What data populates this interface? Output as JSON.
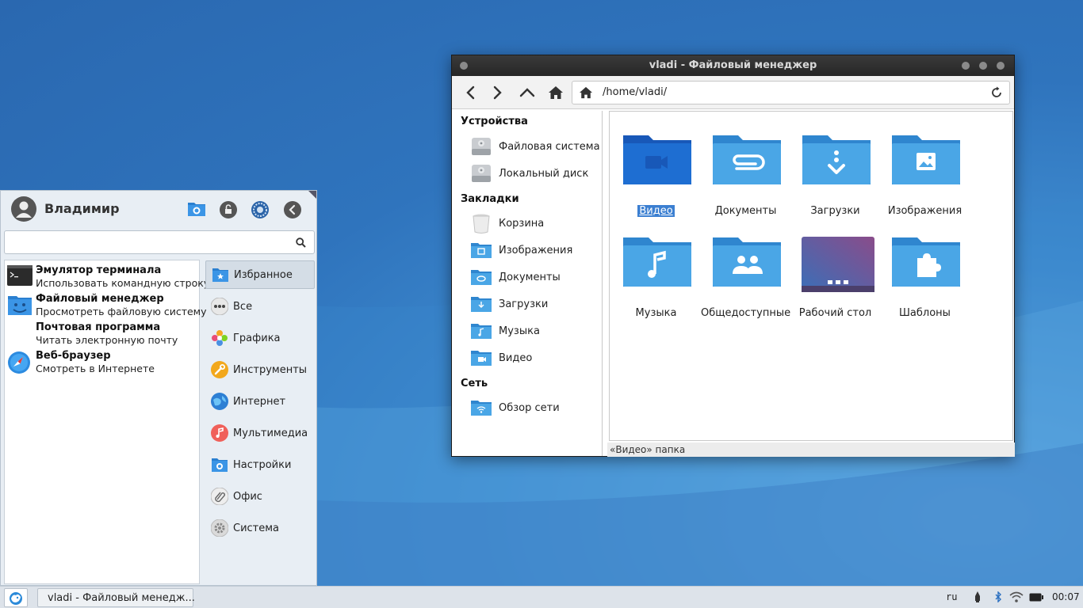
{
  "file_manager": {
    "title": "vladi - Файловый менеджер",
    "path": "/home/vladi/",
    "sidebar": {
      "devices_header": "Устройства",
      "devices": [
        {
          "label": "Файловая система",
          "icon": "drive-icon"
        },
        {
          "label": "Локальный диск",
          "icon": "drive-icon"
        }
      ],
      "bookmarks_header": "Закладки",
      "bookmarks": [
        {
          "label": "Корзина",
          "icon": "trash-icon"
        },
        {
          "label": "Изображения",
          "icon": "folder-pictures-icon"
        },
        {
          "label": "Документы",
          "icon": "folder-documents-icon"
        },
        {
          "label": "Загрузки",
          "icon": "folder-downloads-icon"
        },
        {
          "label": "Музыка",
          "icon": "folder-music-icon"
        },
        {
          "label": "Видео",
          "icon": "folder-video-icon"
        }
      ],
      "network_header": "Сеть",
      "network": [
        {
          "label": "Обзор сети",
          "icon": "folder-network-icon"
        }
      ]
    },
    "files": [
      {
        "name": "Видео",
        "icon": "folder-video-icon",
        "selected": true
      },
      {
        "name": "Документы",
        "icon": "folder-documents-icon"
      },
      {
        "name": "Загрузки",
        "icon": "folder-downloads-icon"
      },
      {
        "name": "Изображения",
        "icon": "folder-pictures-icon"
      },
      {
        "name": "Музыка",
        "icon": "folder-music-icon"
      },
      {
        "name": "Общедоступные",
        "icon": "folder-public-icon"
      },
      {
        "name": "Рабочий стол",
        "icon": "folder-desktop-icon"
      },
      {
        "name": "Шаблоны",
        "icon": "folder-templates-icon"
      }
    ],
    "status": "«Видео» папка",
    "colors": {
      "folder": "#4aa6e6",
      "folder_dark": "#2f86cf",
      "selected_folder": "#1e6ed2",
      "selection": "#3b7fd1"
    }
  },
  "menu": {
    "user": "Владимир",
    "search": {
      "value": "",
      "placeholder": ""
    },
    "favorites": [
      {
        "title": "Эмулятор терминала",
        "desc": "Использовать командную строку",
        "icon": "terminal-icon"
      },
      {
        "title": "Файловый менеджер",
        "desc": "Просмотреть файловую систему",
        "icon": "file-manager-icon"
      },
      {
        "title": "Почтовая программа",
        "desc": "Читать электронную почту",
        "icon": "mail-icon"
      },
      {
        "title": "Веб-браузер",
        "desc": "Смотреть в Интернете",
        "icon": "web-browser-icon"
      }
    ],
    "categories": [
      {
        "label": "Избранное",
        "icon": "favorites-icon",
        "active": true
      },
      {
        "label": "Все",
        "icon": "all-icon"
      },
      {
        "label": "Графика",
        "icon": "graphics-icon"
      },
      {
        "label": "Инструменты",
        "icon": "tools-icon"
      },
      {
        "label": "Интернет",
        "icon": "internet-icon"
      },
      {
        "label": "Мультимедиа",
        "icon": "multimedia-icon"
      },
      {
        "label": "Настройки",
        "icon": "settings-icon"
      },
      {
        "label": "Офис",
        "icon": "office-icon"
      },
      {
        "label": "Система",
        "icon": "system-icon"
      }
    ]
  },
  "taskbar": {
    "window_button": "vladi - Файловый менедж...",
    "keyboard_layout": "ru",
    "clock": "00:07"
  }
}
